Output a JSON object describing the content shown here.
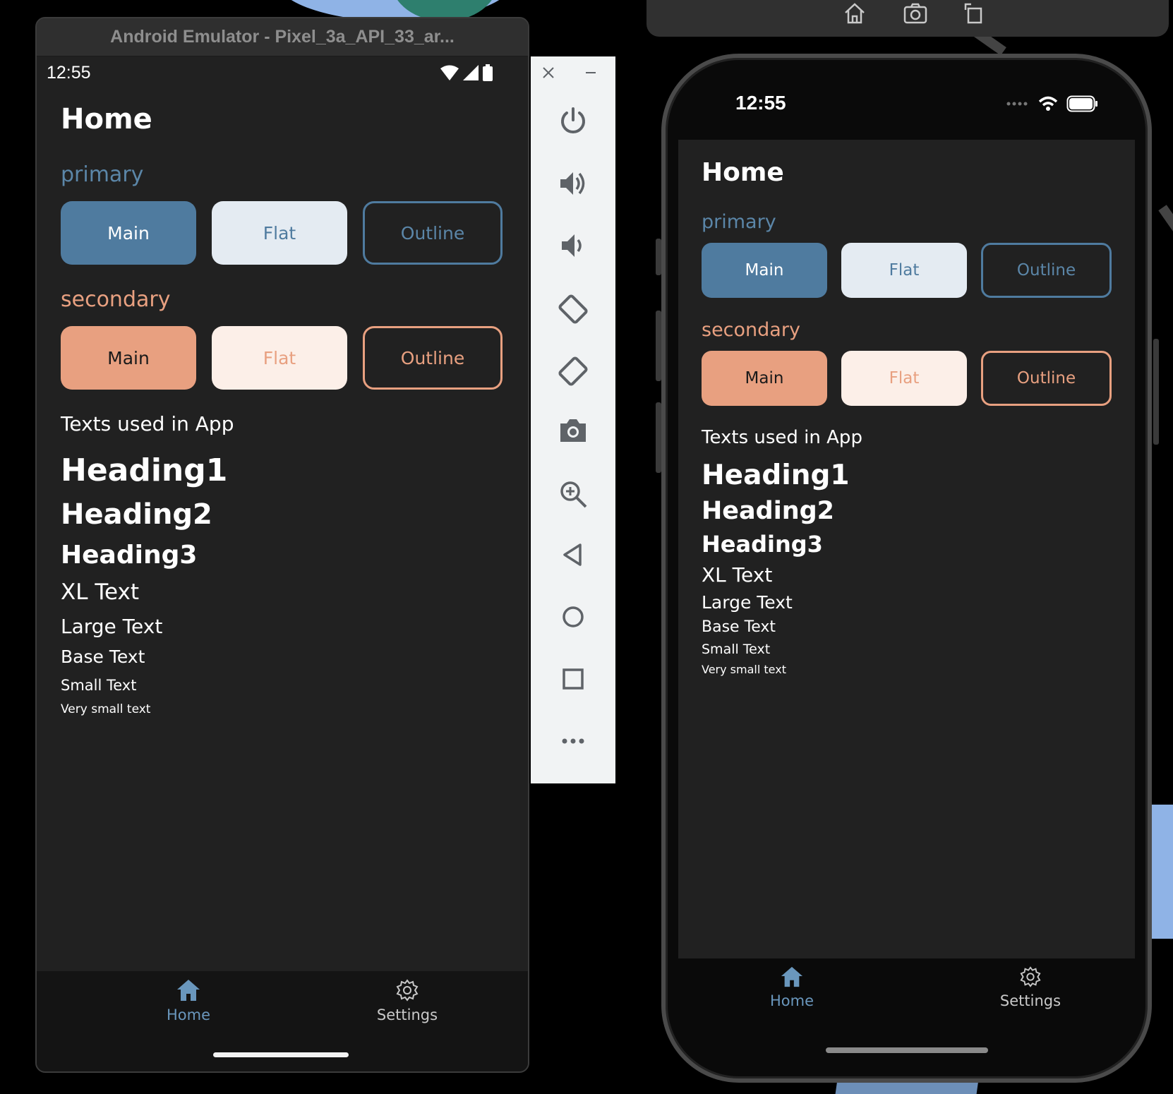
{
  "android": {
    "window_title": "Android Emulator - Pixel_3a_API_33_ar...",
    "status_time": "12:55",
    "page_title": "Home",
    "primary": {
      "label": "primary",
      "main": "Main",
      "flat": "Flat",
      "outline": "Outline"
    },
    "secondary": {
      "label": "secondary",
      "main": "Main",
      "flat": "Flat",
      "outline": "Outline"
    },
    "texts_label": "Texts used in App",
    "texts": {
      "heading1": "Heading1",
      "heading2": "Heading2",
      "heading3": "Heading3",
      "xl": "XL Text",
      "large": "Large Text",
      "base": "Base Text",
      "small": "Small Text",
      "very_small": "Very small text"
    },
    "tabs": {
      "home": "Home",
      "settings": "Settings"
    }
  },
  "emulator_toolbar": {
    "icons": [
      "close-icon",
      "minimize-icon",
      "power-icon",
      "volume-up-icon",
      "volume-down-icon",
      "rotate-left-icon",
      "rotate-right-icon",
      "camera-icon",
      "zoom-icon",
      "back-icon",
      "home-circle-icon",
      "overview-square-icon",
      "more-icon"
    ]
  },
  "ios": {
    "status_time": "12:55",
    "page_title": "Home",
    "primary": {
      "label": "primary",
      "main": "Main",
      "flat": "Flat",
      "outline": "Outline"
    },
    "secondary": {
      "label": "secondary",
      "main": "Main",
      "flat": "Flat",
      "outline": "Outline"
    },
    "texts_label": "Texts used in App",
    "texts": {
      "heading1": "Heading1",
      "heading2": "Heading2",
      "heading3": "Heading3",
      "xl": "XL Text",
      "large": "Large Text",
      "base": "Base Text",
      "small": "Small Text",
      "very_small": "Very small text"
    },
    "tabs": {
      "home": "Home",
      "settings": "Settings"
    }
  },
  "colors": {
    "primary": "#4f7b9f",
    "primary_light": "#e4ebf2",
    "secondary": "#e8a080",
    "secondary_light": "#fcefe8",
    "background": "#212121",
    "tabbar": "#141414"
  }
}
